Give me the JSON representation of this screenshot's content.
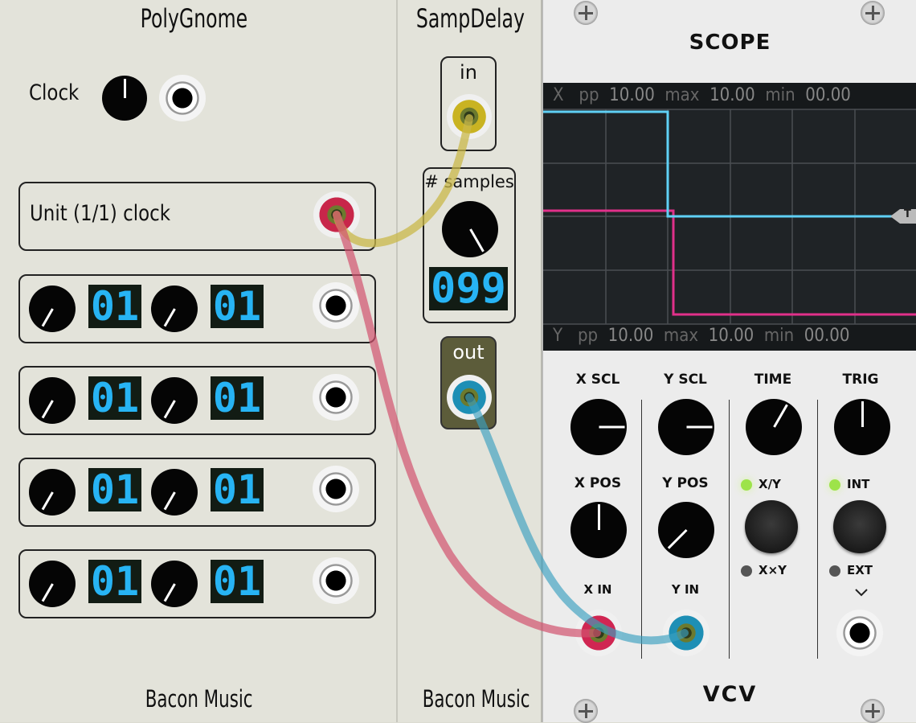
{
  "polygnome": {
    "title": "PolyGnome",
    "clock_label": "Clock",
    "unit_label": "Unit (1/1) clock",
    "rows": [
      {
        "num_value": "01",
        "den_value": "01"
      },
      {
        "num_value": "01",
        "den_value": "01"
      },
      {
        "num_value": "01",
        "den_value": "01"
      },
      {
        "num_value": "01",
        "den_value": "01"
      }
    ],
    "brand": "Bacon Music"
  },
  "sampdelay": {
    "title": "SampDelay",
    "in_label": "in",
    "samples_label": "# samples",
    "samples_value": "099",
    "out_label": "out",
    "brand": "Bacon Music"
  },
  "scope": {
    "title": "SCOPE",
    "x_readout": {
      "channel": "X",
      "pp_label": "pp",
      "pp": "10.00",
      "max_label": "max",
      "max": "10.00",
      "min_label": "min",
      "min": "00.00"
    },
    "y_readout": {
      "channel": "Y",
      "pp_label": "pp",
      "pp": "10.00",
      "max_label": "max",
      "max": "10.00",
      "min_label": "min",
      "min": "00.00"
    },
    "trigger_marker": "T",
    "x_scl": "X SCL",
    "y_scl": "Y SCL",
    "time": "TIME",
    "trig": "TRIG",
    "x_pos": "X POS",
    "y_pos": "Y POS",
    "xy_label": "X/Y",
    "xxy_label": "X×Y",
    "int_label": "INT",
    "ext_label": "EXT",
    "x_in": "X IN",
    "y_in": "Y IN",
    "brand": "VCV"
  },
  "colors": {
    "cable_yellow": "#c9b84a",
    "cable_red": "#d2536f",
    "cable_blue": "#3aa0c0",
    "trace_x": "#5fd0f5",
    "trace_y": "#e0308a",
    "led_green": "#9de34a",
    "display_blue": "#27b4f4"
  }
}
